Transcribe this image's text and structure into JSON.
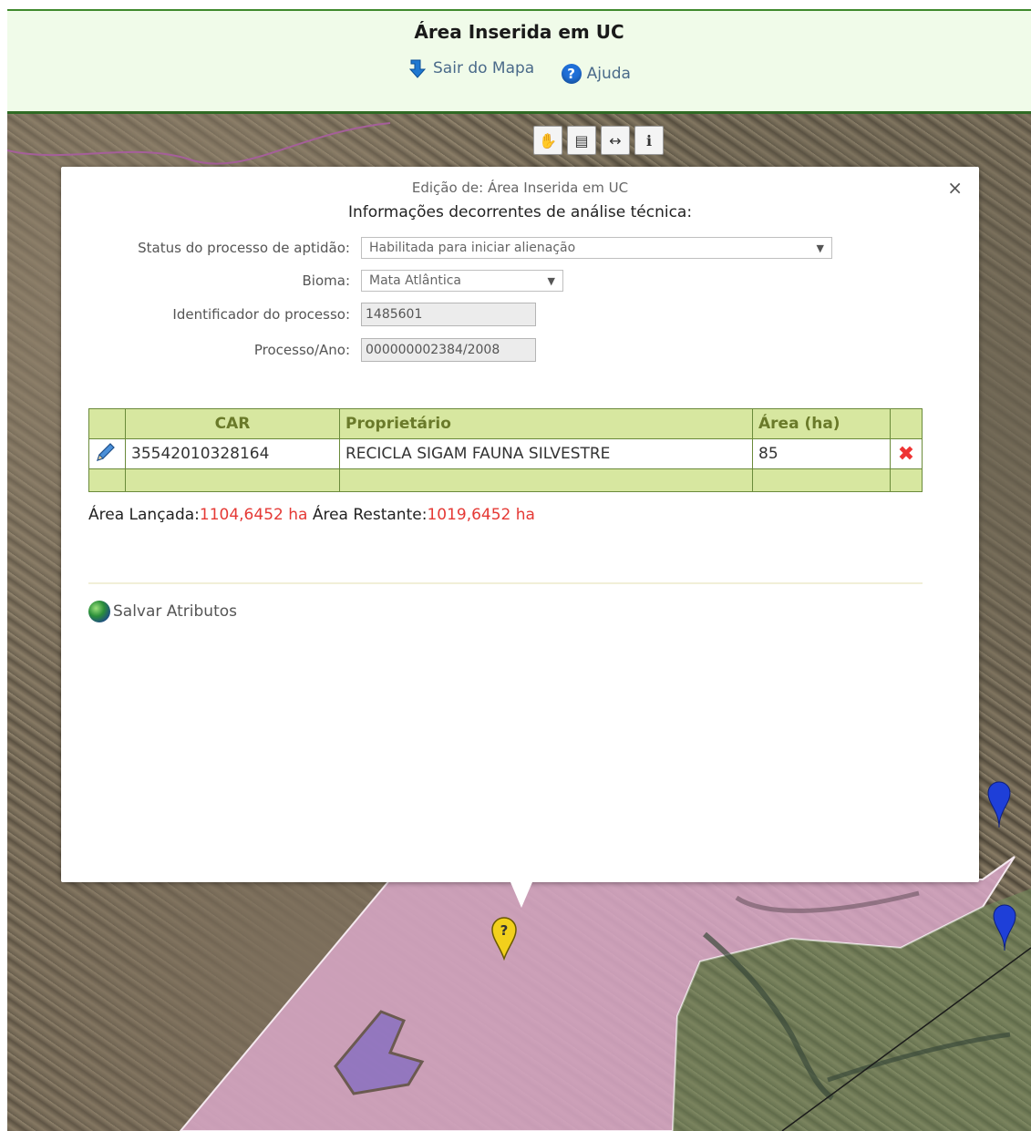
{
  "header": {
    "title": "Área Inserida em UC",
    "exit_label": "Sair do Mapa",
    "help_label": "Ajuda"
  },
  "map_tools": [
    {
      "icon": "pan-hand-icon"
    },
    {
      "icon": "area-measure-icon"
    },
    {
      "icon": "distance-measure-icon"
    },
    {
      "icon": "info-icon"
    }
  ],
  "popup": {
    "subtitle": "Edição de: Área Inserida em UC",
    "heading": "Informações decorrentes de análise técnica:",
    "close_glyph": "×",
    "fields": {
      "status": {
        "label": "Status do processo de aptidão:",
        "value": "Habilitada para iniciar alienação"
      },
      "bioma": {
        "label": "Bioma:",
        "value": "Mata Atlântica"
      },
      "identificador": {
        "label": "Identificador do processo:",
        "value": "1485601"
      },
      "processo": {
        "label": "Processo/Ano:",
        "value": "000000002384/2008"
      }
    },
    "table": {
      "headers": [
        "",
        "CAR",
        "Proprietário",
        "Área (ha)",
        ""
      ],
      "rows": [
        {
          "car": "35542010328164",
          "owner": "RECICLA SIGAM FAUNA SILVESTRE",
          "area": "85"
        }
      ]
    },
    "area_lancada_label": "Área Lançada:",
    "area_lancada_value": "1104,6452 ha",
    "area_restante_label": "Área Restante:",
    "area_restante_value": "1019,6452 ha",
    "save_label": "Salvar Atributos"
  },
  "colors": {
    "header_bg": "#f0fbe9",
    "table_header_bg": "#d7e7a0",
    "value_red": "#e53935",
    "polygon_fill": "#d9a8c8"
  }
}
